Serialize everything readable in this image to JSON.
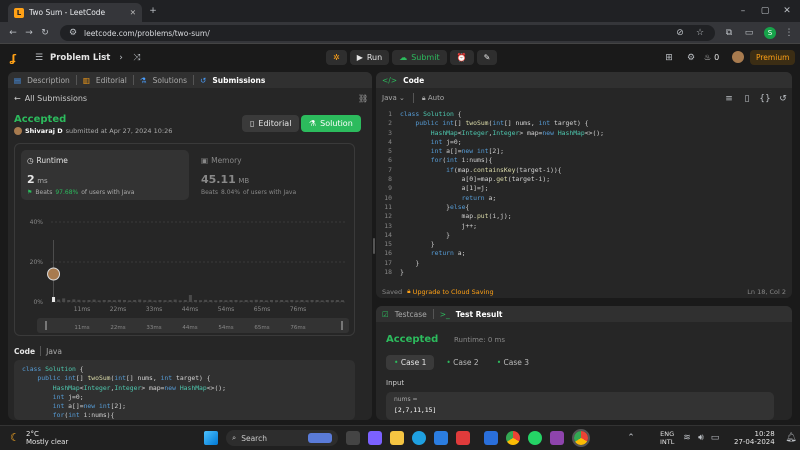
{
  "browser": {
    "tab_title": "Two Sum - LeetCode",
    "url": "leetcode.com/problems/two-sum/"
  },
  "leetcode": {
    "problem_list": "Problem List",
    "run": "Run",
    "submit": "Submit",
    "streak": "0",
    "premium": "Premium"
  },
  "left_tabs": [
    "Description",
    "Editorial",
    "Solutions",
    "Submissions"
  ],
  "submission": {
    "back": "All Submissions",
    "status": "Accepted",
    "user": "Shivaraj D",
    "submitted": "submitted at Apr 27, 2024 10:26",
    "editorial_btn": "Editorial",
    "solution_btn": "Solution",
    "runtime_label": "Runtime",
    "runtime_value": "2",
    "runtime_unit": "ms",
    "runtime_beats_pre": "Beats",
    "runtime_beats": "97.68%",
    "runtime_beats_post": "of users with Java",
    "memory_label": "Memory",
    "memory_value": "45.11",
    "memory_unit": "MB",
    "memory_beats_pre": "Beats",
    "memory_beats": "8.04%",
    "memory_beats_post": "of users with Java",
    "code_label": "Code",
    "code_lang": "Java"
  },
  "chart_data": {
    "type": "bar",
    "y_ticks": [
      "40%",
      "20%",
      "0%"
    ],
    "ylim": [
      0,
      40
    ],
    "x_ticks": [
      "11ms",
      "22ms",
      "33ms",
      "44ms",
      "54ms",
      "65ms",
      "76ms"
    ],
    "values": [
      2.5,
      1.2,
      1.8,
      1.0,
      1.3,
      1.1,
      0.9,
      1.0,
      1.2,
      0.8,
      1.0,
      1.0,
      0.9,
      1.1,
      1.0,
      0.8,
      1.0,
      1.2,
      0.9,
      1.1,
      0.8,
      1.0,
      0.9,
      1.0,
      1.2,
      0.8,
      1.0,
      3.5,
      1.0,
      0.9,
      1.1,
      1.0,
      0.8,
      1.0,
      0.9,
      1.0,
      1.0,
      0.8,
      1.0,
      0.9,
      1.1,
      1.0,
      0.8,
      1.0,
      0.9,
      1.0,
      0.9,
      1.0,
      0.8,
      1.0,
      0.9,
      1.0,
      1.0,
      0.8,
      1.0,
      0.9,
      1.0,
      0.9
    ],
    "highlight_index": 0
  },
  "editor": {
    "title": "Code",
    "lang": "Java",
    "auto": "Auto",
    "saved": "Saved",
    "upgrade": "Upgrade to Cloud Saving",
    "position": "Ln 18, Col 2"
  },
  "test": {
    "tab1": "Testcase",
    "tab2": "Test Result",
    "status": "Accepted",
    "runtime": "Runtime: 0 ms",
    "cases": [
      "Case 1",
      "Case 2",
      "Case 3"
    ],
    "input_label": "Input",
    "param": "nums =",
    "value": "[2,7,11,15]"
  },
  "taskbar": {
    "temp": "2°C",
    "weather": "Mostly clear",
    "search": "Search",
    "lang1": "ENG",
    "lang2": "INTL",
    "time": "10:28",
    "date": "27-04-2024"
  }
}
